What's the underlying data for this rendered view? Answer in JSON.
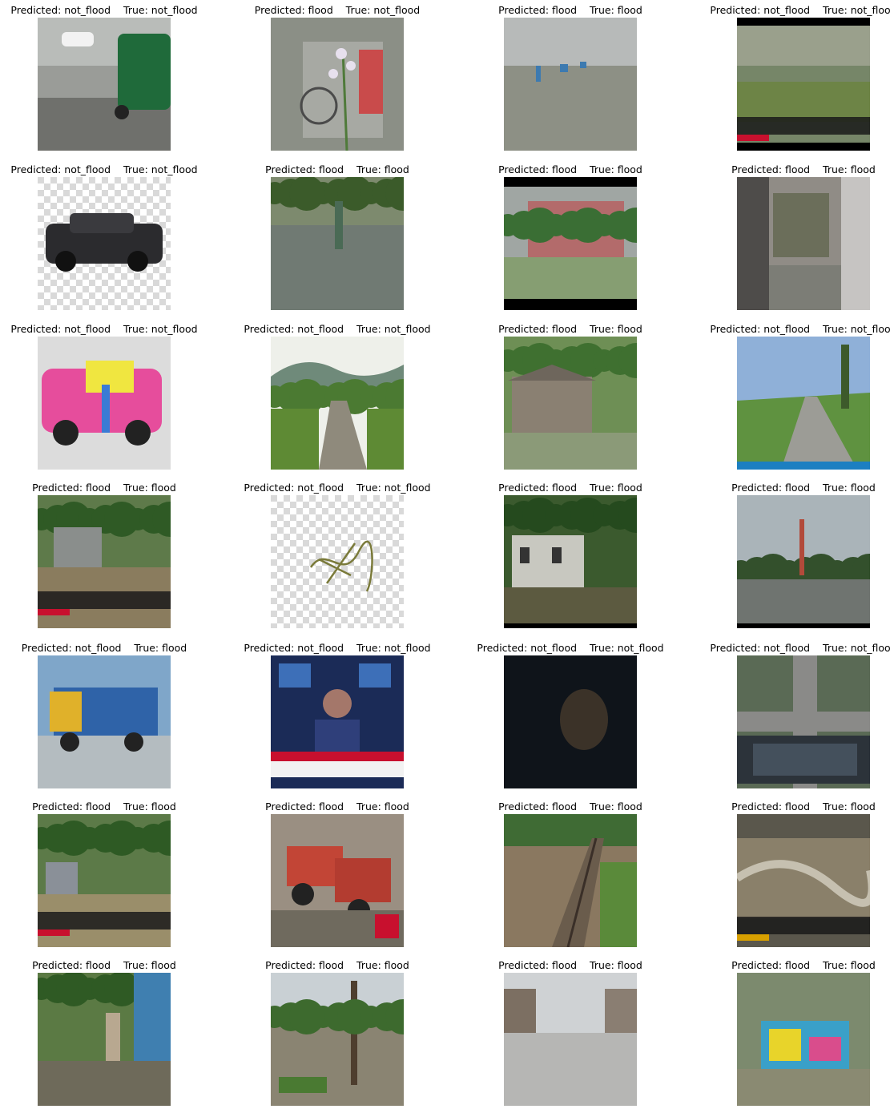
{
  "figure": {
    "samples": [
      {
        "pred_label": "Predicted: not_flood",
        "true_label": "True: not_flood",
        "scene": "street-rickshaw-rain"
      },
      {
        "pred_label": "Predicted: flood",
        "true_label": "True: not_flood",
        "scene": "flowers-blurred-rickshaw"
      },
      {
        "pred_label": "Predicted: flood",
        "true_label": "True: flood",
        "scene": "flooded-road-rickshaws"
      },
      {
        "pred_label": "Predicted: not_flood",
        "true_label": "True: not_flood",
        "scene": "grassy-field-news-frame"
      },
      {
        "pred_label": "Predicted: not_flood",
        "true_label": "True: not_flood",
        "scene": "black-suv-checkerboard"
      },
      {
        "pred_label": "Predicted: flood",
        "true_label": "True: flood",
        "scene": "person-walking-flooded-path"
      },
      {
        "pred_label": "Predicted: flood",
        "true_label": "True: flood",
        "scene": "storm-trees-tin-house"
      },
      {
        "pred_label": "Predicted: flood",
        "true_label": "True: flood",
        "scene": "flooded-alley-blurred"
      },
      {
        "pred_label": "Predicted: not_flood",
        "true_label": "True: not_flood",
        "scene": "painted-car-children"
      },
      {
        "pred_label": "Predicted: not_flood",
        "true_label": "True: not_flood",
        "scene": "village-road-hills"
      },
      {
        "pred_label": "Predicted: flood",
        "true_label": "True: flood",
        "scene": "flooded-tin-house"
      },
      {
        "pred_label": "Predicted: not_flood",
        "true_label": "True: not_flood",
        "scene": "rural-road-stock-photo"
      },
      {
        "pred_label": "Predicted: flood",
        "true_label": "True: flood",
        "scene": "flooded-village-live-news"
      },
      {
        "pred_label": "Predicted: not_flood",
        "true_label": "True: not_flood",
        "scene": "map-sketch-checkerboard"
      },
      {
        "pred_label": "Predicted: flood",
        "true_label": "True: flood",
        "scene": "flooded-old-building"
      },
      {
        "pred_label": "Predicted: flood",
        "true_label": "True: flood",
        "scene": "flash-flood-tower"
      },
      {
        "pred_label": "Predicted: not_flood",
        "true_label": "True: flood",
        "scene": "truck-in-floodwater"
      },
      {
        "pred_label": "Predicted: not_flood",
        "true_label": "True: not_flood",
        "scene": "news-anchor-studio"
      },
      {
        "pred_label": "Predicted: not_flood",
        "true_label": "True: not_flood",
        "scene": "dark-face-frame"
      },
      {
        "pred_label": "Predicted: not_flood",
        "true_label": "True: not_flood",
        "scene": "aerial-intersection-software"
      },
      {
        "pred_label": "Predicted: flood",
        "true_label": "True: flood",
        "scene": "flooded-shed-live-news"
      },
      {
        "pred_label": "Predicted: flood",
        "true_label": "True: flood",
        "scene": "red-tractors-flooded-street"
      },
      {
        "pred_label": "Predicted: flood",
        "true_label": "True: flood",
        "scene": "railway-track-flood"
      },
      {
        "pred_label": "Predicted: flood",
        "true_label": "True: flood",
        "scene": "raging-flood-news"
      },
      {
        "pred_label": "Predicted: flood",
        "true_label": "True: flood",
        "scene": "man-walking-rain-village"
      },
      {
        "pred_label": "Predicted: flood",
        "true_label": "True: flood",
        "scene": "flooded-river-trees"
      },
      {
        "pred_label": "Predicted: flood",
        "true_label": "True: flood",
        "scene": "flooded-town-street"
      },
      {
        "pred_label": "Predicted: flood",
        "true_label": "True: flood",
        "scene": "blurred-flooded-house"
      }
    ]
  }
}
